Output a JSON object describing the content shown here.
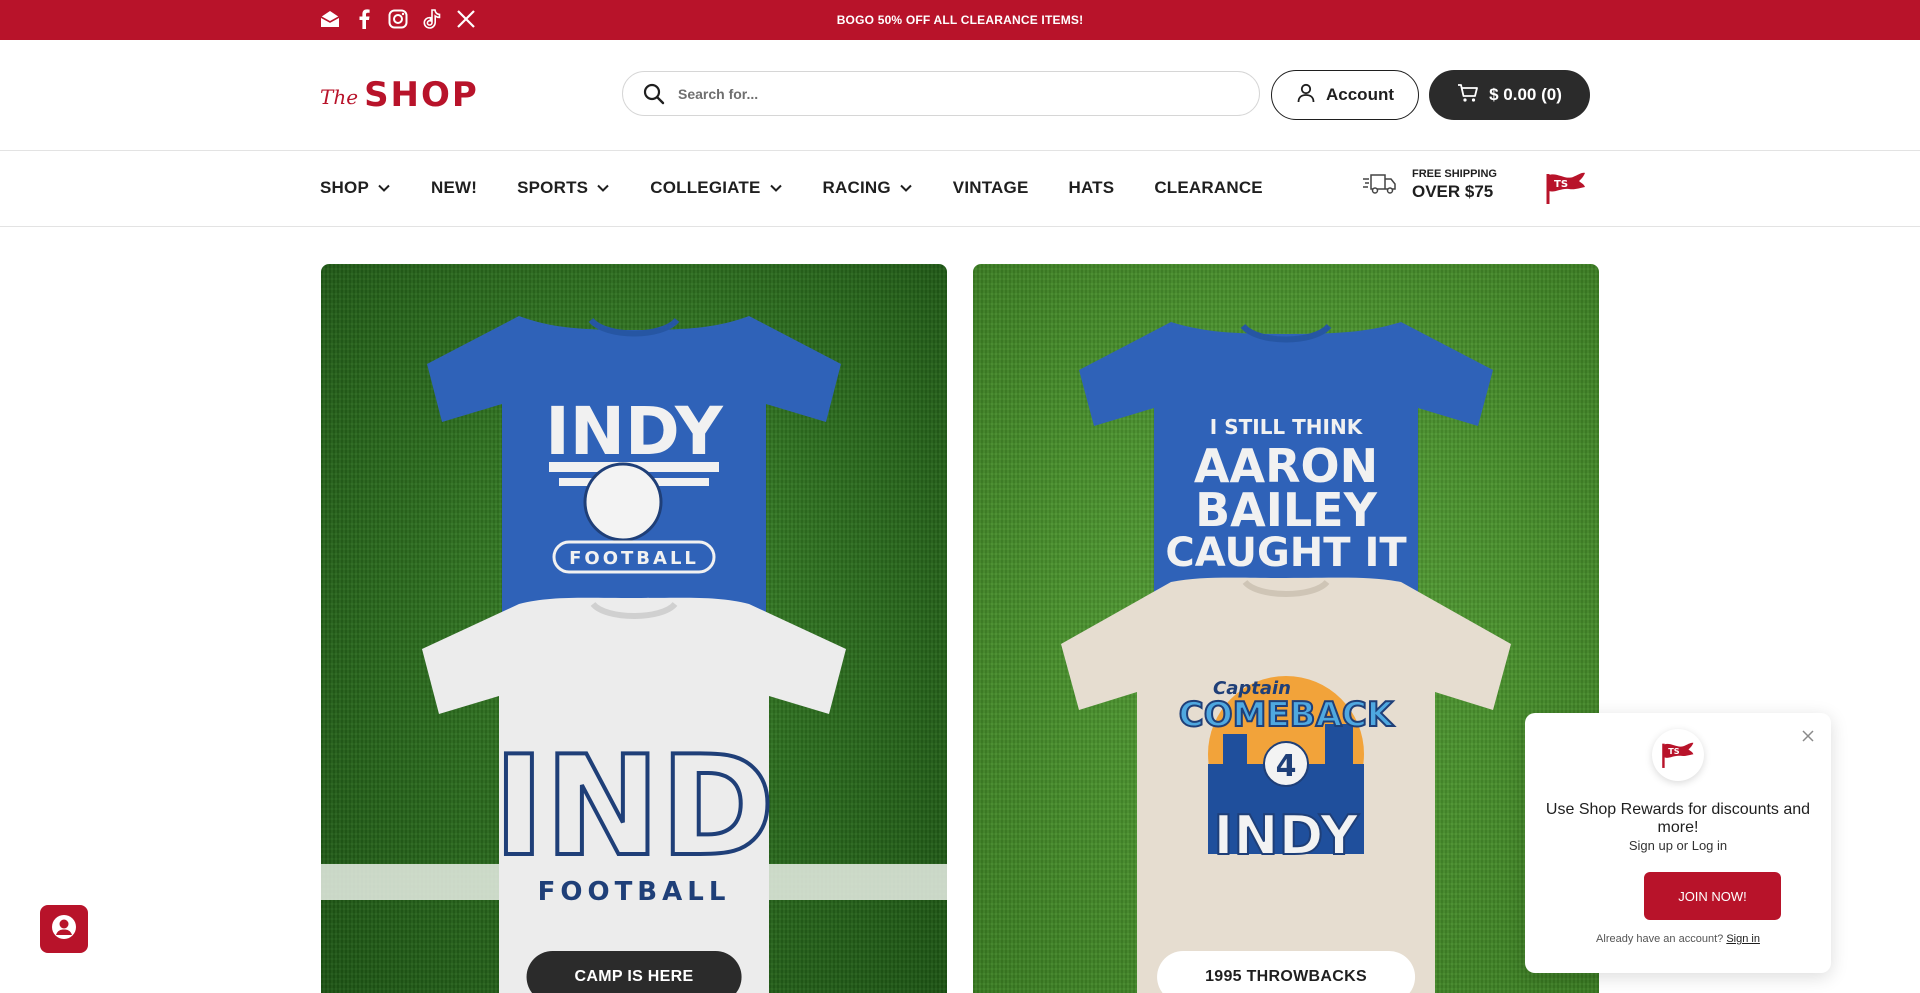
{
  "colors": {
    "brand_red": "#b8132a",
    "dark": "#2b2b2b",
    "turf_dark": "#2e7020",
    "turf_light": "#4b932e",
    "shirt_blue": "#2f62b8"
  },
  "announcement": {
    "text": "BOGO 50% OFF ALL CLEARANCE ITEMS!",
    "socials": [
      "email-icon",
      "facebook-icon",
      "instagram-icon",
      "tiktok-icon",
      "x-icon"
    ]
  },
  "header": {
    "logo_the": "The",
    "logo_shop": "SHOP",
    "search_placeholder": "Search for...",
    "account_label": "Account",
    "cart_label": "$ 0.00 (0)"
  },
  "nav": {
    "items": [
      {
        "label": "SHOP",
        "has_dropdown": true
      },
      {
        "label": "NEW!",
        "has_dropdown": false
      },
      {
        "label": "SPORTS",
        "has_dropdown": true
      },
      {
        "label": "COLLEGIATE",
        "has_dropdown": true
      },
      {
        "label": "RACING",
        "has_dropdown": true
      },
      {
        "label": "VINTAGE",
        "has_dropdown": false
      },
      {
        "label": "HATS",
        "has_dropdown": false
      },
      {
        "label": "CLEARANCE",
        "has_dropdown": false
      }
    ],
    "shipping_small": "FREE SHIPPING",
    "shipping_big": "OVER $75"
  },
  "hero": {
    "left": {
      "cta": "CAMP IS HERE",
      "shirt_top": {
        "line1": "INDY",
        "line2": "FOOTBALL"
      },
      "shirt_bottom": {
        "line1": "IND",
        "line2": "FOOTBALL"
      }
    },
    "right": {
      "cta": "1995 THROWBACKS",
      "shirt_top": {
        "line1": "I STILL THINK",
        "line2": "AARON",
        "line3": "BAILEY",
        "line4": "CAUGHT IT"
      },
      "shirt_bottom": {
        "line1": "Captain",
        "line2": "COMEBACK",
        "line3": "INDY",
        "number": "4"
      }
    }
  },
  "rewards": {
    "title": "Use Shop Rewards for discounts and more!",
    "subtitle": "Sign up or Log in",
    "join_label": "JOIN NOW!",
    "already_text": "Already have an account?",
    "signin_label": "Sign in"
  }
}
